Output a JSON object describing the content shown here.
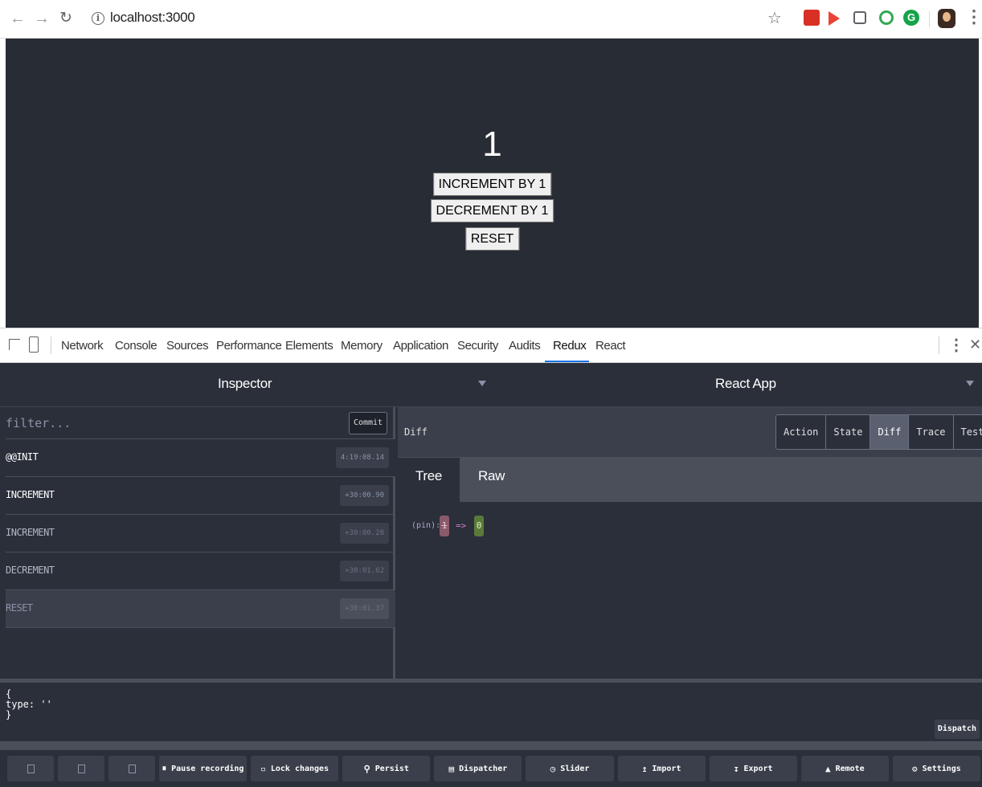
{
  "browser": {
    "url": "localhost:3000"
  },
  "app": {
    "counter_value": "1",
    "increment_label": "INCREMENT BY 1",
    "decrement_label": "DECREMENT BY 1",
    "reset_label": "RESET"
  },
  "devtools": {
    "tabs": [
      "Network",
      "Console",
      "Sources",
      "Performance",
      "Elements",
      "Memory",
      "Application",
      "Security",
      "Audits",
      "Redux",
      "React"
    ],
    "active_tab": "Redux"
  },
  "redux": {
    "monitor_title": "Inspector",
    "instance_title": "React App",
    "filter_placeholder": "filter...",
    "commit_label": "Commit",
    "actions": [
      {
        "name": "@@INIT",
        "time": "4:19:08.14",
        "state": "normal"
      },
      {
        "name": "INCREMENT",
        "time": "+30:00.90",
        "state": "normal"
      },
      {
        "name": "INCREMENT",
        "time": "+30:00.28",
        "state": "dim"
      },
      {
        "name": "DECREMENT",
        "time": "+30:01.62",
        "state": "dim"
      },
      {
        "name": "RESET",
        "time": "+30:01.37",
        "state": "skipped"
      }
    ],
    "diff_label": "Diff",
    "modes": [
      "Action",
      "State",
      "Diff",
      "Trace",
      "Test"
    ],
    "active_mode": "Diff",
    "subtabs": [
      "Tree",
      "Raw"
    ],
    "active_subtab": "Tree",
    "diff": {
      "key": "(pin):",
      "old_value": "1",
      "arrow": "=>",
      "new_value": "0"
    },
    "dispatch_code": "{\ntype: ''\n}",
    "dispatch_label": "Dispatch",
    "toolbar": {
      "pause": "Pause recording",
      "lock": "Lock changes",
      "persist": "Persist",
      "dispatcher": "Dispatcher",
      "slider": "Slider",
      "import": "Import",
      "export": "Export",
      "remote": "Remote",
      "settings": "Settings"
    }
  },
  "colors": {
    "panel_bg": "#2a2f3a",
    "app_bg": "#282c34",
    "active_tab_underline": "#1a73e8",
    "diff_removed": "#8a5a6a",
    "diff_added": "#5a7a3a"
  }
}
